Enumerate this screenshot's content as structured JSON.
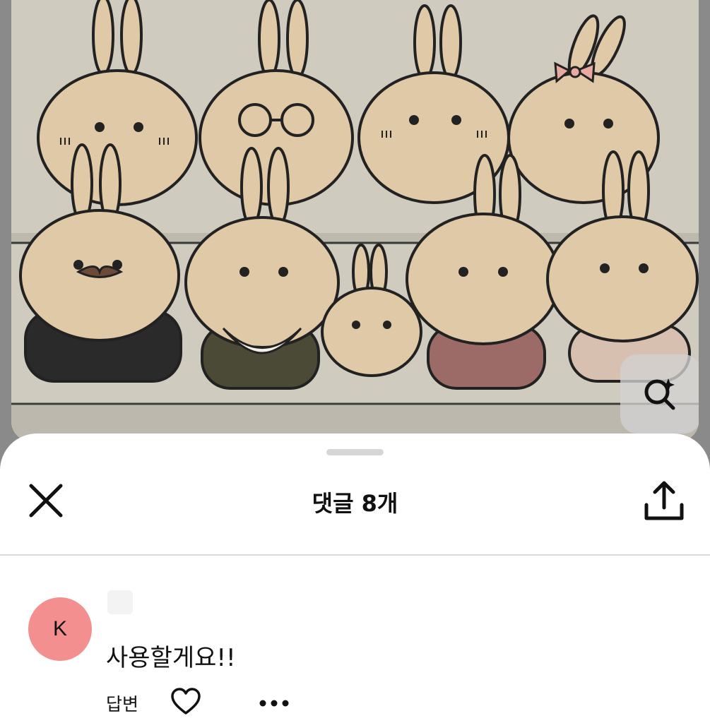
{
  "pin": {
    "image_alt": "",
    "lens_icon": "visual-search-sparkle-icon"
  },
  "sheet": {
    "title": "댓글 8개",
    "close_icon": "close-icon",
    "share_icon": "share-upload-icon"
  },
  "comment": {
    "avatar_initial": "K",
    "avatar_color": "#f48f8f",
    "author_name": "",
    "text": "사용할게요!!",
    "reply_label": "답변",
    "like_icon": "heart-outline-icon",
    "more_icon": "more-dots-icon"
  }
}
